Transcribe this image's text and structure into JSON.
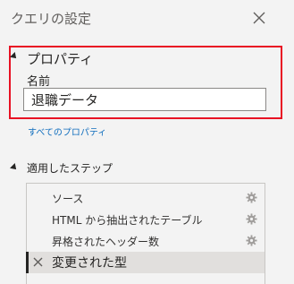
{
  "panel": {
    "title": "クエリの設定"
  },
  "properties": {
    "header": "プロパティ",
    "name_label": "名前",
    "name_value": "退職データ",
    "all_properties_link": "すべてのプロパティ",
    "highlight_color": "#e81123"
  },
  "applied_steps": {
    "header": "適用したステップ",
    "items": [
      {
        "label": "ソース",
        "icon": "gear-icon"
      },
      {
        "label": "HTML から抽出されたテーブル",
        "icon": "gear-icon"
      },
      {
        "label": "昇格されたヘッダー数",
        "icon": "gear-icon"
      },
      {
        "label": "変更された型",
        "icon": "delete-icon",
        "selected": true
      }
    ]
  }
}
